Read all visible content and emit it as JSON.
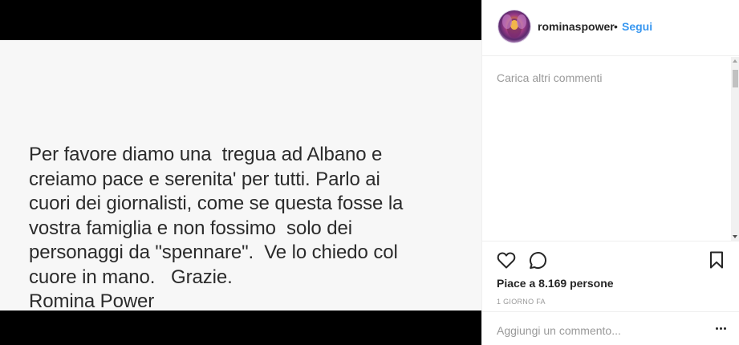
{
  "post": {
    "image_text_lines": [
      "Per favore diamo una  tregua ad Albano e",
      "creiamo pace e serenita' per tutti. Parlo ai",
      "cuori dei giornalisti, come se questa fosse la",
      "vostra famiglia e non fossimo  solo dei",
      "personaggi da \"spennare\".  Ve lo chiedo col",
      "cuore in mano.   Grazie.",
      "Romina Power"
    ]
  },
  "header": {
    "username": "rominaspower",
    "separator": "•",
    "follow_label": "Segui"
  },
  "comments": {
    "load_more_label": "Carica altri commenti"
  },
  "actions": {
    "icons": [
      "heart-icon",
      "comment-icon",
      "bookmark-icon"
    ],
    "likes_text": "Piace a 8.169 persone",
    "timestamp": "1 giorno fa"
  },
  "add_comment": {
    "placeholder": "Aggiungi un commento...",
    "more_icon": "more-options-icon"
  },
  "colors": {
    "accent": "#3897f0",
    "text": "#262626",
    "muted": "#999999",
    "border": "#efefef"
  }
}
